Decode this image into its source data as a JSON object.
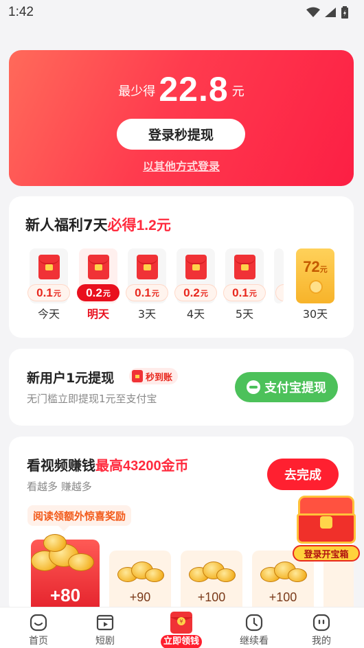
{
  "status_bar": {
    "time": "1:42"
  },
  "hero": {
    "prefix": "最少得",
    "amount": "22.8",
    "unit": "元",
    "login_button": "登录秒提现",
    "other_login": "以其他方式登录"
  },
  "welfare": {
    "title_black": "新人福利7天",
    "title_red": "必得",
    "title_amount": "1.2元",
    "days": [
      {
        "amount": "0.1",
        "unit": "元",
        "label": "今天"
      },
      {
        "amount": "0.2",
        "unit": "元",
        "label": "明天"
      },
      {
        "amount": "0.1",
        "unit": "元",
        "label": "3天"
      },
      {
        "amount": "0.2",
        "unit": "元",
        "label": "4天"
      },
      {
        "amount": "0.1",
        "unit": "元",
        "label": "5天"
      }
    ],
    "big": {
      "amount": "72",
      "unit": "元",
      "label": "30天"
    }
  },
  "newuser": {
    "title": "新用户1元提现",
    "badge": "秒到账",
    "subtitle": "无门槛立即提现1元至支付宝",
    "alipay_button": "支付宝提现"
  },
  "video": {
    "title_black": "看视频赚钱",
    "title_red": "最高",
    "title_num": "43200",
    "title_unit": "金币",
    "subtitle": "看越多 赚越多",
    "go_button": "去完成",
    "tip": "阅读领额外惊喜奖励",
    "rewards": [
      "+80",
      "+90",
      "+100",
      "+100"
    ]
  },
  "chest": {
    "label": "登录开宝箱"
  },
  "tabbar": {
    "items": [
      {
        "label": "首页",
        "icon": "home-face-icon"
      },
      {
        "label": "短剧",
        "icon": "play-icon"
      },
      {
        "label": "立即领钱",
        "icon": "red-envelope-icon"
      },
      {
        "label": "继续看",
        "icon": "clock-icon"
      },
      {
        "label": "我的",
        "icon": "profile-face-icon"
      }
    ]
  },
  "colors": {
    "accent_red": "#ff2a3d",
    "alipay_green": "#4cc15a",
    "coin_gold": "#f4b52a"
  }
}
